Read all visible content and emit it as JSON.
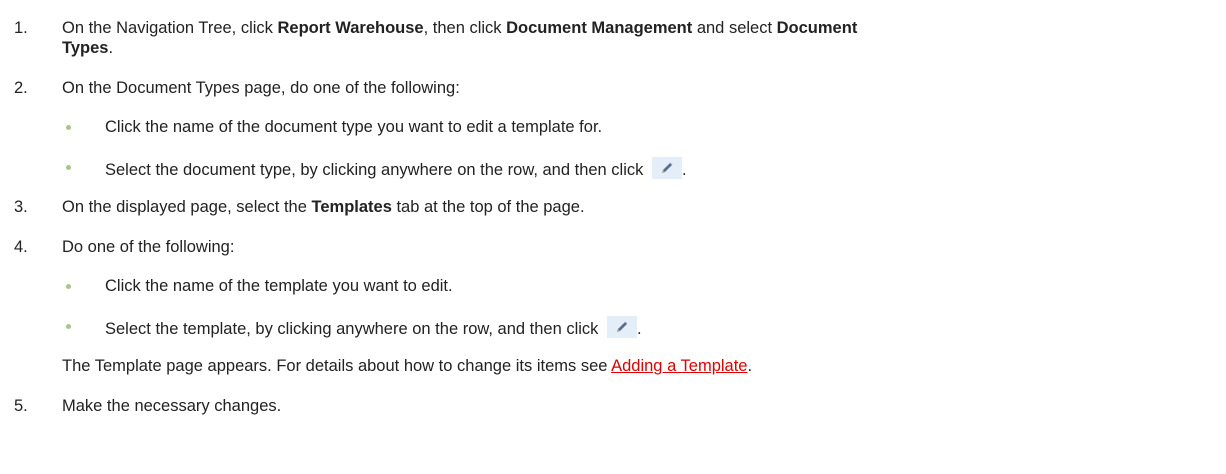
{
  "steps": [
    {
      "num": "1.",
      "line1_pre": "On the Navigation Tree, click ",
      "line1_b1": "Report Warehouse",
      "line1_mid": ", then click ",
      "line1_b2": "Document Management",
      "line1_mid2": " and select ",
      "line1_b3": "Document",
      "line2_b": "Types",
      "line2_post": "."
    },
    {
      "num": "2.",
      "text": "On the Document Types page, do one of the following:",
      "bullets": [
        "Click the name of the document type you want to edit a template for.",
        "Select the document type, by clicking anywhere on the row, and then click"
      ],
      "after_icon": "."
    },
    {
      "num": "3.",
      "pre": "On the displayed page, select the ",
      "bold": "Templates",
      "post": " tab at the top of the page."
    },
    {
      "num": "4.",
      "text": "Do one of the following:",
      "bullets": [
        "Click the name of the template you want to edit.",
        "Select the template, by clicking anywhere on the row, and then click"
      ],
      "after_icon": ".",
      "note_pre": "The Template page appears. For details about how to change its items see ",
      "note_link": "Adding a Template",
      "note_post": "."
    },
    {
      "num": "5.",
      "text": "Make the necessary changes."
    }
  ],
  "icons": {
    "edit": "pencil-icon"
  },
  "colors": {
    "link": "#e00000",
    "bullet": "#a8c48a",
    "icon_bg": "#e4eef8"
  }
}
